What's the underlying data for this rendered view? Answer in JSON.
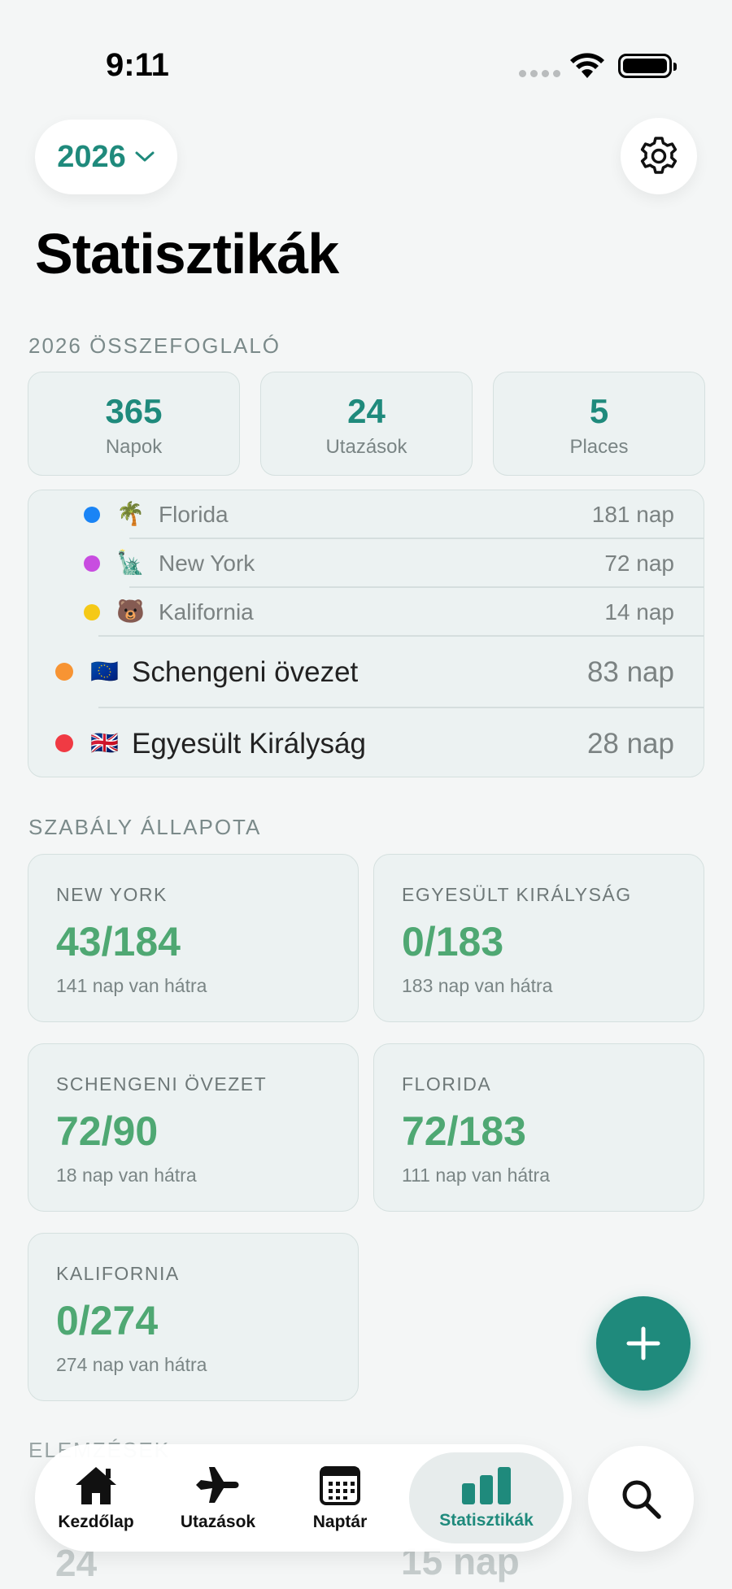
{
  "status": {
    "time": "9:11"
  },
  "header": {
    "year": "2026",
    "title": "Statisztikák"
  },
  "summary": {
    "label": "2026 ÖSSZEFOGLALÓ",
    "cards": [
      {
        "value": "365",
        "label": "Napok"
      },
      {
        "value": "24",
        "label": "Utazások"
      },
      {
        "value": "5",
        "label": "Places"
      }
    ]
  },
  "places": [
    {
      "emoji": "🌴",
      "name": "Florida",
      "days": "181 nap",
      "color": "#1a84f5"
    },
    {
      "emoji": "🗽",
      "name": "New York",
      "days": "72 nap",
      "color": "#c84de0"
    },
    {
      "emoji": "🐻",
      "name": "Kalifornia",
      "days": "14 nap",
      "color": "#f5c917"
    },
    {
      "emoji": "🇪🇺",
      "name": "Schengeni övezet",
      "days": "83 nap",
      "color": "#f79433"
    },
    {
      "emoji": "🇬🇧",
      "name": "Egyesült Királyság",
      "days": "28 nap",
      "color": "#f03a43"
    }
  ],
  "rules": {
    "label": "SZABÁLY ÁLLAPOTA",
    "cards": [
      {
        "title": "NEW YORK",
        "value": "43/184",
        "remaining": "141 nap van hátra"
      },
      {
        "title": "EGYESÜLT KIRÁLYSÁG",
        "value": "0/183",
        "remaining": "183 nap van hátra"
      },
      {
        "title": "SCHENGENI ÖVEZET",
        "value": "72/90",
        "remaining": "18 nap van hátra"
      },
      {
        "title": "FLORIDA",
        "value": "72/183",
        "remaining": "111 nap van hátra"
      },
      {
        "title": "KALIFORNIA",
        "value": "0/274",
        "remaining": "274 nap van hátra"
      }
    ]
  },
  "analysis": {
    "label": "ELEMZÉSEK",
    "value_1": "24",
    "value_2": "15 nap"
  },
  "tabs": [
    {
      "label": "Kezdőlap",
      "icon": "house-icon"
    },
    {
      "label": "Utazások",
      "icon": "airplane-icon"
    },
    {
      "label": "Naptár",
      "icon": "calendar-icon"
    },
    {
      "label": "Statisztikák",
      "icon": "chart-icon",
      "active": true
    }
  ],
  "colors": {
    "accent": "#1f8a7c",
    "rule_green": "#4fa873"
  }
}
